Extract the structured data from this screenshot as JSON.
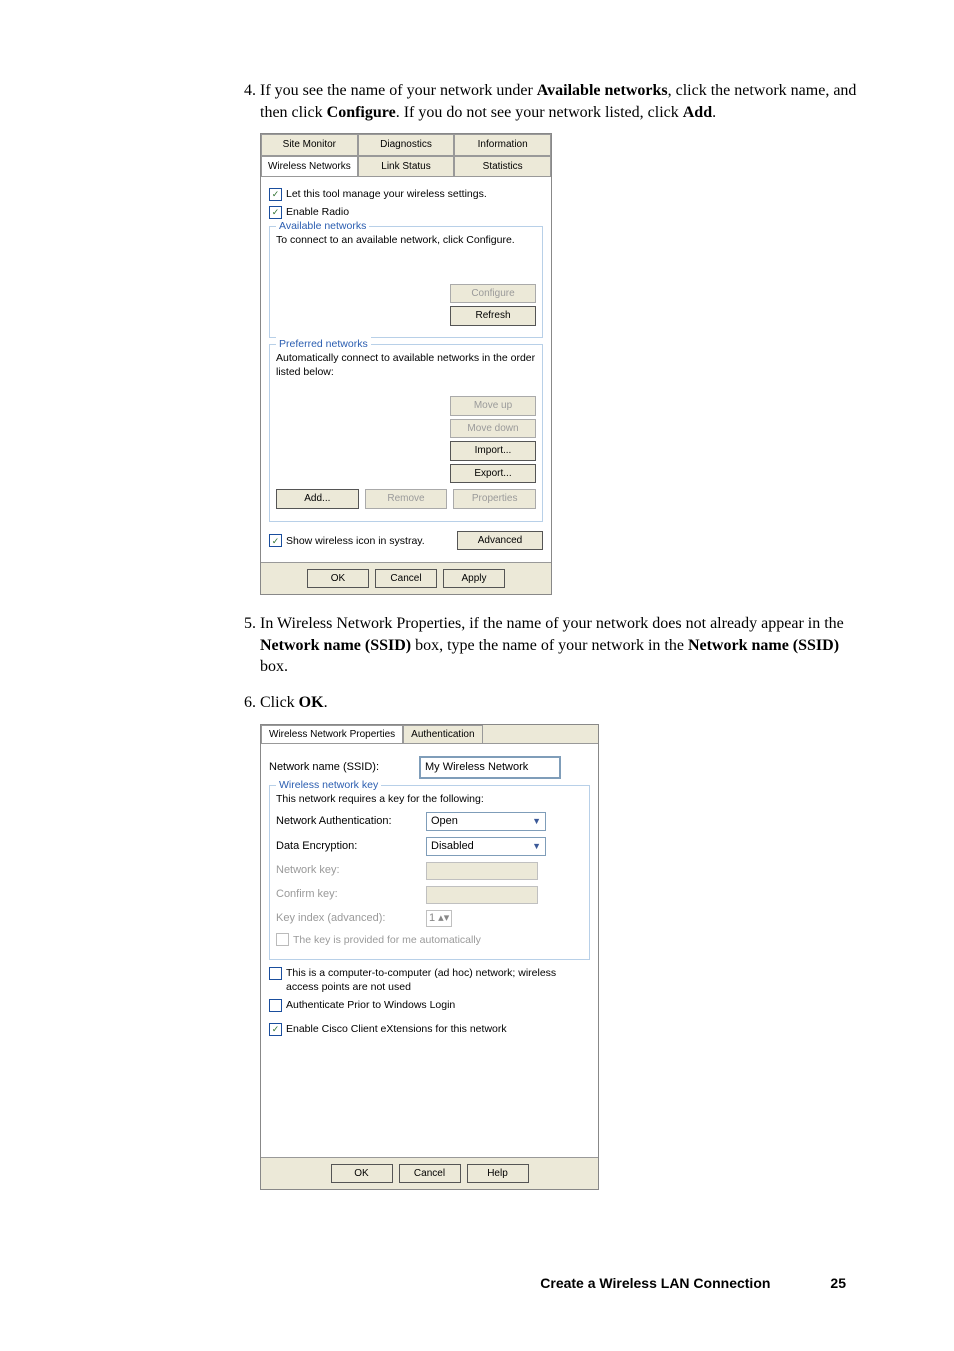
{
  "steps": {
    "s4": {
      "pre": "If you see the name of your network under ",
      "bold1": "Available networks",
      "mid1": ", click the network name, and then click ",
      "bold2": "Configure",
      "mid2": ". If you do not see your network listed, click ",
      "bold3": "Add",
      "post": "."
    },
    "s5": {
      "pre": "In Wireless Network Properties, if the name of your network does not already appear in the ",
      "bold1": "Network name (SSID)",
      "mid1": " box, type the name of your network in the ",
      "bold2": "Network name (SSID)",
      "post": " box."
    },
    "s6": {
      "pre": "Click ",
      "bold1": "OK",
      "post": "."
    }
  },
  "dlg1": {
    "tabs": {
      "siteMonitor": "Site Monitor",
      "diagnostics": "Diagnostics",
      "information": "Information",
      "wirelessNetworks": "Wireless Networks",
      "linkStatus": "Link Status",
      "statistics": "Statistics"
    },
    "letTool": "Let this tool manage your wireless settings.",
    "enableRadio": "Enable Radio",
    "avail": {
      "legend": "Available networks",
      "text": "To connect to an available network, click Configure.",
      "configure": "Configure",
      "refresh": "Refresh"
    },
    "pref": {
      "legend": "Preferred networks",
      "text": "Automatically connect to available networks in the order listed below:",
      "moveUp": "Move up",
      "moveDown": "Move down",
      "import": "Import...",
      "export": "Export...",
      "add": "Add...",
      "remove": "Remove",
      "properties": "Properties"
    },
    "systray": "Show wireless icon in systray.",
    "advanced": "Advanced",
    "ok": "OK",
    "cancel": "Cancel",
    "apply": "Apply"
  },
  "dlg2": {
    "tabs": {
      "wnp": "Wireless Network Properties",
      "auth": "Authentication"
    },
    "ssidLabel": "Network name (SSID):",
    "ssidValue": "My Wireless Network",
    "wkey": {
      "legend": "Wireless network key",
      "req": "This network requires a key for the following:",
      "netauth": "Network Authentication:",
      "netauthVal": "Open",
      "dataenc": "Data Encryption:",
      "dataencVal": "Disabled",
      "netkey": "Network key:",
      "confirm": "Confirm key:",
      "keyidx": "Key index (advanced):",
      "keyidxVal": "1",
      "auto": "The key is provided for me automatically"
    },
    "adhoc": "This is a computer-to-computer (ad hoc) network; wireless access points are not used",
    "authPrior": "Authenticate Prior to Windows Login",
    "cisco": "Enable Cisco Client eXtensions for this network",
    "ok": "OK",
    "cancel": "Cancel",
    "help": "Help"
  },
  "footer": {
    "title": "Create a Wireless LAN Connection",
    "page": "25"
  }
}
